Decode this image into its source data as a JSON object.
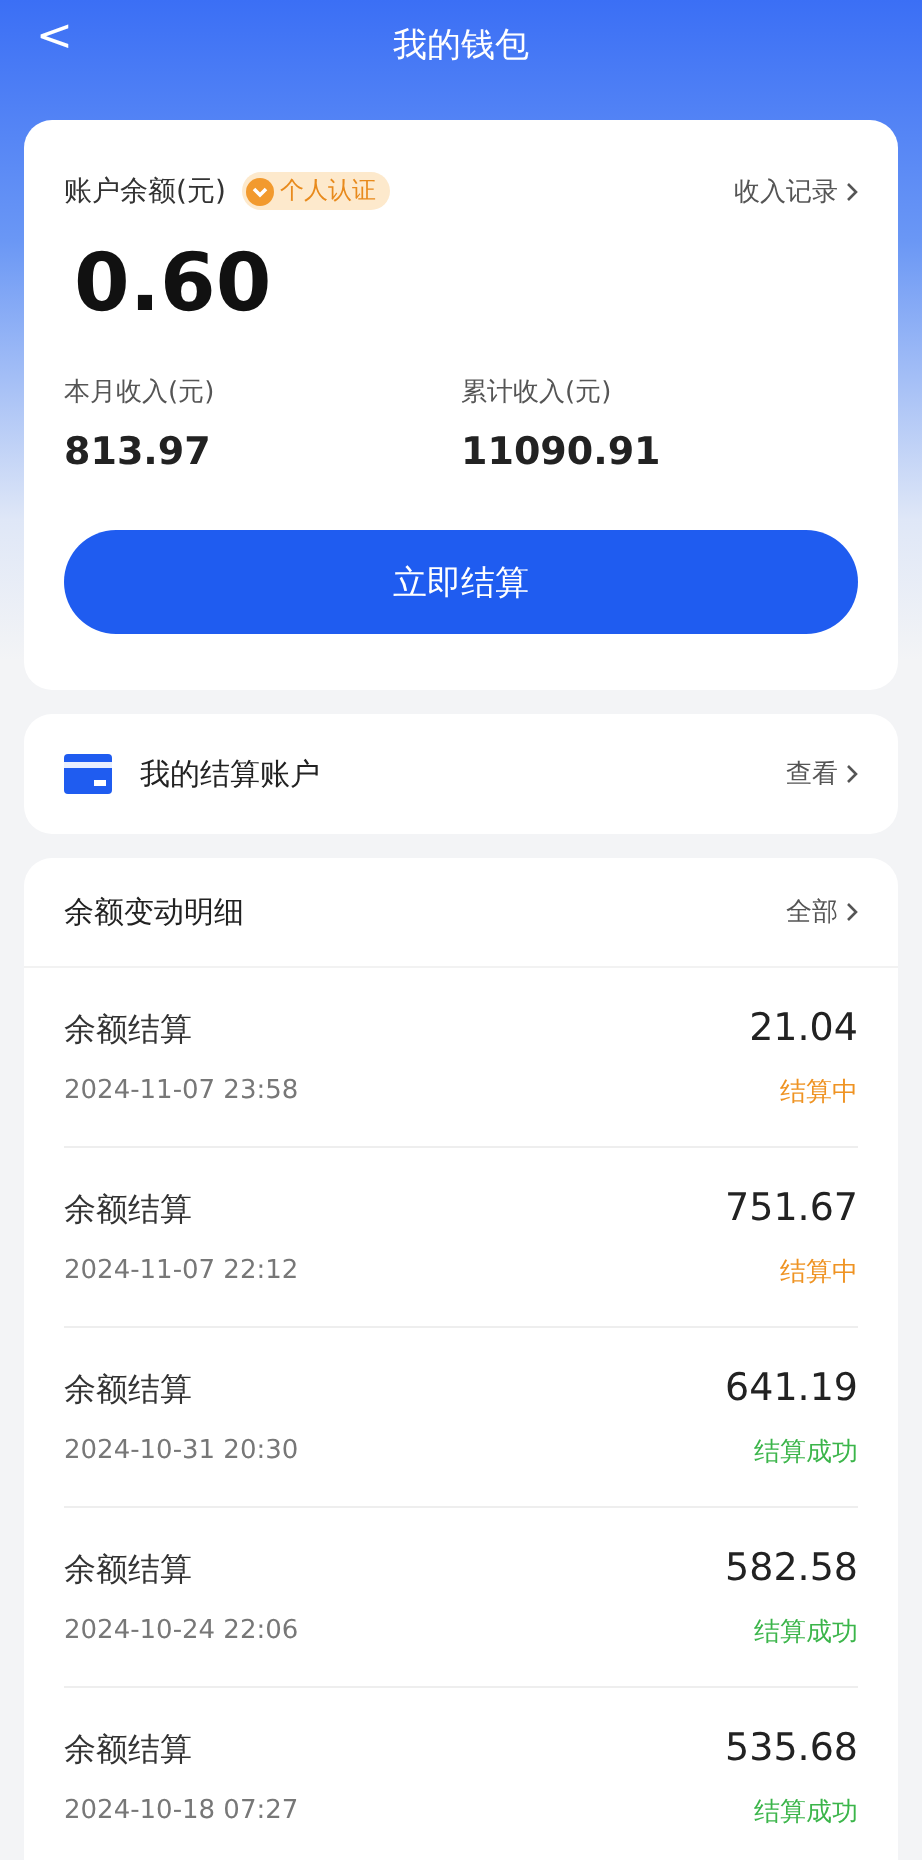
{
  "header": {
    "back": "<",
    "title": "我的钱包"
  },
  "balance_card": {
    "label": "账户余额(元)",
    "badge": "个人认证",
    "record_link": "收入记录",
    "amount": "0.60",
    "stats": [
      {
        "label": "本月收入(元)",
        "value": "813.97"
      },
      {
        "label": "累计收入(元)",
        "value": "11090.91"
      }
    ],
    "button": "立即结算"
  },
  "account": {
    "title": "我的结算账户",
    "link": "查看"
  },
  "details": {
    "title": "余额变动明细",
    "link": "全部",
    "rows": [
      {
        "name": "余额结算",
        "time": "2024-11-07 23:58",
        "amount": "21.04",
        "status": "结算中",
        "kind": "pending"
      },
      {
        "name": "余额结算",
        "time": "2024-11-07 22:12",
        "amount": "751.67",
        "status": "结算中",
        "kind": "pending"
      },
      {
        "name": "余额结算",
        "time": "2024-10-31 20:30",
        "amount": "641.19",
        "status": "结算成功",
        "kind": "success"
      },
      {
        "name": "余额结算",
        "time": "2024-10-24 22:06",
        "amount": "582.58",
        "status": "结算成功",
        "kind": "success"
      },
      {
        "name": "余额结算",
        "time": "2024-10-18 07:27",
        "amount": "535.68",
        "status": "结算成功",
        "kind": "success"
      }
    ]
  }
}
